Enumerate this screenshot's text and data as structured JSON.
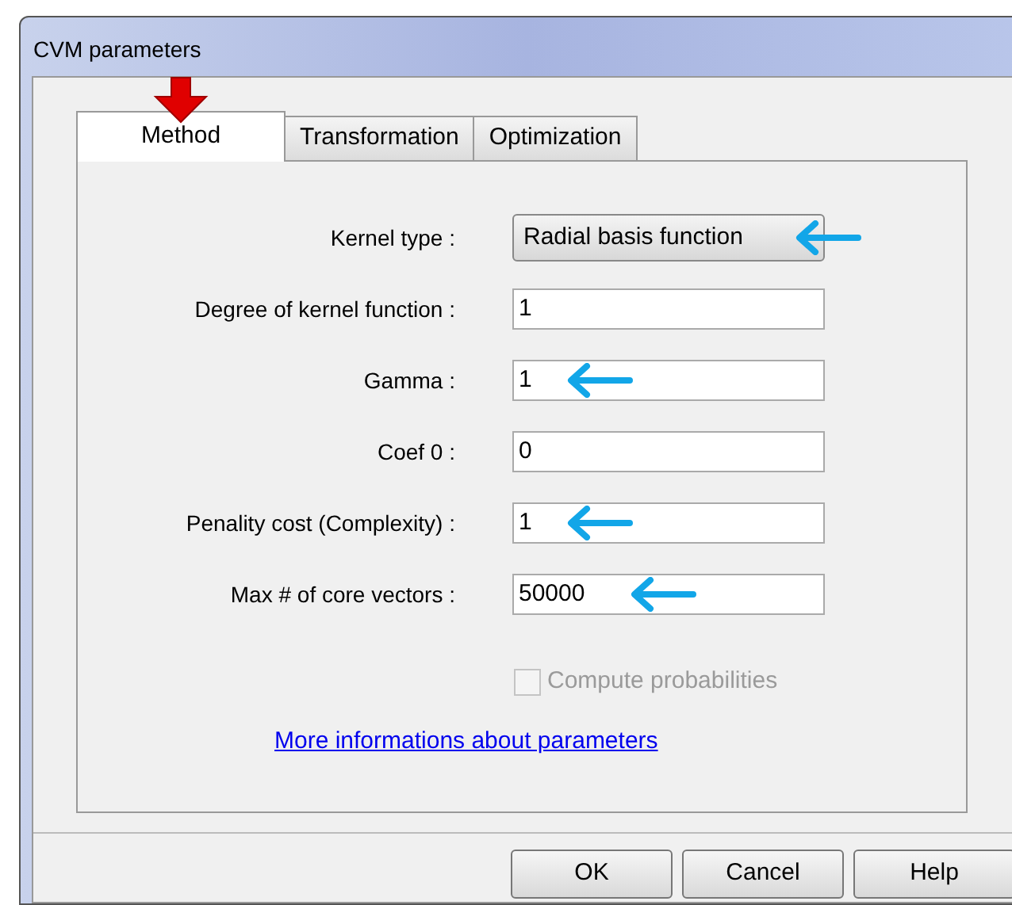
{
  "window": {
    "title": "CVM parameters"
  },
  "tabs": [
    {
      "label": "Method",
      "selected": true,
      "arrow": true
    },
    {
      "label": "Transformation",
      "selected": false,
      "arrow": false
    },
    {
      "label": "Optimization",
      "selected": false,
      "arrow": false
    }
  ],
  "fields": [
    {
      "label": "Kernel type :",
      "kind": "dropdown",
      "value": "Radial basis function",
      "arrow": true
    },
    {
      "label": "Degree of kernel function :",
      "kind": "input",
      "value": "1",
      "arrow": false
    },
    {
      "label": "Gamma :",
      "kind": "input",
      "value": "1",
      "arrow": true
    },
    {
      "label": "Coef 0 :",
      "kind": "input",
      "value": "0",
      "arrow": false
    },
    {
      "label": "Penality cost (Complexity) :",
      "kind": "input",
      "value": "1",
      "arrow": true
    },
    {
      "label": "Max # of core vectors :",
      "kind": "input",
      "value": "50000",
      "arrow": true
    }
  ],
  "checkbox": {
    "label": "Compute probabilities",
    "checked": false,
    "disabled": true
  },
  "link": "More informations about parameters",
  "buttons": [
    "OK",
    "Cancel",
    "Help"
  ]
}
